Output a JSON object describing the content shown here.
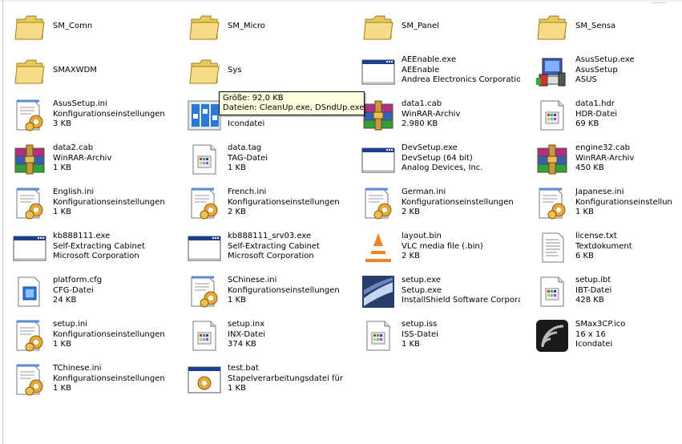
{
  "files": [
    {
      "lines": [
        "SM_Comn"
      ],
      "icon": "folder-icon"
    },
    {
      "lines": [
        "SM_Micro"
      ],
      "icon": "folder-icon"
    },
    {
      "lines": [
        "SM_Panel"
      ],
      "icon": "folder-icon"
    },
    {
      "lines": [
        "SM_Sensa"
      ],
      "icon": "folder-icon"
    },
    {
      "lines": [
        "SMAXWDM"
      ],
      "icon": "folder-icon"
    },
    {
      "lines": [
        "Sys"
      ],
      "icon": "folder-icon"
    },
    {
      "lines": [
        "AEEnable.exe",
        "AEEnable",
        "Andrea Electronics Corporation"
      ],
      "icon": "application-window-icon"
    },
    {
      "lines": [
        "AsusSetup.exe",
        "AsusSetup",
        "ASUS"
      ],
      "icon": "computer-setup-icon"
    },
    {
      "lines": [
        "AsusSetup.ini",
        "Konfigurationseinstellungen",
        "3 KB"
      ],
      "icon": "settings-file-icon"
    },
    {
      "lines": [
        "",
        "",
        "Icondatei"
      ],
      "icon": "icon-file-icon"
    },
    {
      "lines": [
        "data1.cab",
        "WinRAR-Archiv",
        "2.980 KB"
      ],
      "icon": "winrar-archive-icon"
    },
    {
      "lines": [
        "data1.hdr",
        "HDR-Datei",
        "69 KB"
      ],
      "icon": "generic-file-icon"
    },
    {
      "lines": [
        "data2.cab",
        "WinRAR-Archiv",
        "1 KB"
      ],
      "icon": "winrar-archive-icon"
    },
    {
      "lines": [
        "data.tag",
        "TAG-Datei",
        "1 KB"
      ],
      "icon": "generic-file-icon"
    },
    {
      "lines": [
        "DevSetup.exe",
        "DevSetup (64 bit)",
        "Analog Devices, Inc."
      ],
      "icon": "application-window-icon"
    },
    {
      "lines": [
        "engine32.cab",
        "WinRAR-Archiv",
        "450 KB"
      ],
      "icon": "winrar-archive-icon"
    },
    {
      "lines": [
        "English.ini",
        "Konfigurationseinstellungen",
        "1 KB"
      ],
      "icon": "settings-file-icon"
    },
    {
      "lines": [
        "French.ini",
        "Konfigurationseinstellungen",
        "2 KB"
      ],
      "icon": "settings-file-icon"
    },
    {
      "lines": [
        "German.ini",
        "Konfigurationseinstellungen",
        "2 KB"
      ],
      "icon": "settings-file-icon"
    },
    {
      "lines": [
        "Japanese.ini",
        "Konfigurationseinstellun",
        "1 KB"
      ],
      "icon": "settings-file-icon"
    },
    {
      "lines": [
        "kb888111.exe",
        "Self-Extracting Cabinet",
        "Microsoft Corporation"
      ],
      "icon": "application-window-icon"
    },
    {
      "lines": [
        "kb888111_srv03.exe",
        "Self-Extracting Cabinet",
        "Microsoft Corporation"
      ],
      "icon": "application-window-icon"
    },
    {
      "lines": [
        "layout.bin",
        "VLC media file (.bin)",
        "2 KB"
      ],
      "icon": "vlc-cone-icon"
    },
    {
      "lines": [
        "license.txt",
        "Textdokument",
        "6 KB"
      ],
      "icon": "text-document-icon"
    },
    {
      "lines": [
        "platform.cfg",
        "CFG-Datei",
        "24 KB"
      ],
      "icon": "config-file-icon"
    },
    {
      "lines": [
        "SChinese.ini",
        "Konfigurationseinstellungen",
        "1 KB"
      ],
      "icon": "settings-file-icon"
    },
    {
      "lines": [
        "setup.exe",
        "Setup.exe",
        "InstallShield Software Corpora..."
      ],
      "icon": "installshield-icon"
    },
    {
      "lines": [
        "setup.ibt",
        "IBT-Datei",
        "428 KB"
      ],
      "icon": "generic-file-icon"
    },
    {
      "lines": [
        "setup.ini",
        "Konfigurationseinstellungen",
        "1 KB"
      ],
      "icon": "settings-file-icon"
    },
    {
      "lines": [
        "setup.inx",
        "INX-Datei",
        "374 KB"
      ],
      "icon": "generic-file-icon"
    },
    {
      "lines": [
        "setup.iss",
        "ISS-Datei",
        "1 KB"
      ],
      "icon": "generic-file-icon"
    },
    {
      "lines": [
        "SMax3CP.ico",
        "16 x 16",
        "Icondatei"
      ],
      "icon": "smax-logo-icon"
    },
    {
      "lines": [
        "TChinese.ini",
        "Konfigurationseinstellungen",
        "1 KB"
      ],
      "icon": "settings-file-icon"
    },
    {
      "lines": [
        "test.bat",
        "Stapelverarbeitungsdatei für ...",
        "1 KB"
      ],
      "icon": "batch-file-icon"
    }
  ],
  "tooltip": {
    "line1": "Größe: 92,0 KB",
    "line2": "Dateien: CleanUp.exe, DSndUp.exe"
  }
}
